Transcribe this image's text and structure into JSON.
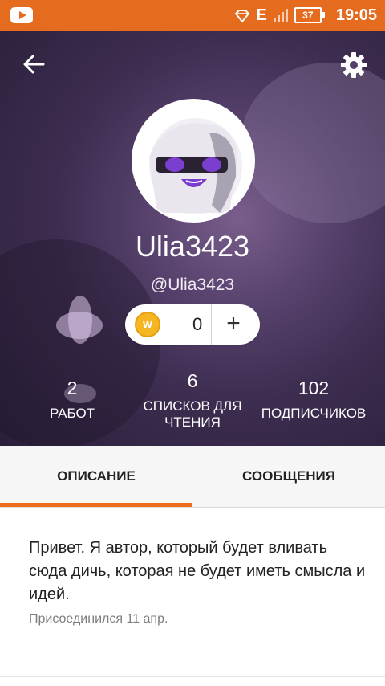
{
  "status_bar": {
    "network": "E",
    "battery": "37",
    "time": "19:05",
    "color": "#e56b1f",
    "icons": [
      "youtube-icon",
      "wifi-diamond-icon",
      "signal-icon",
      "battery-icon"
    ]
  },
  "profile": {
    "display_name": "Ulia3423",
    "handle": "@Ulia3423",
    "coins": "0",
    "stats": [
      {
        "value": "2",
        "label": "РАБОТ"
      },
      {
        "value": "6",
        "label": "СПИСКОВ ДЛЯ ЧТЕНИЯ"
      },
      {
        "value": "102",
        "label": "ПОДПИСЧИКОВ"
      }
    ]
  },
  "tabs": [
    {
      "label": "ОПИСАНИЕ",
      "active": true
    },
    {
      "label": "СООБЩЕНИЯ",
      "active": false
    }
  ],
  "about": {
    "text": "Привет. Я автор, который будет вливать сюда дичь, которая не будет иметь смысла и идей.",
    "joined": "Присоединился 11 апр."
  },
  "colors": {
    "accent": "#ef6c1f",
    "header_bg": "#3d2d50",
    "coin": "#f5b623"
  }
}
